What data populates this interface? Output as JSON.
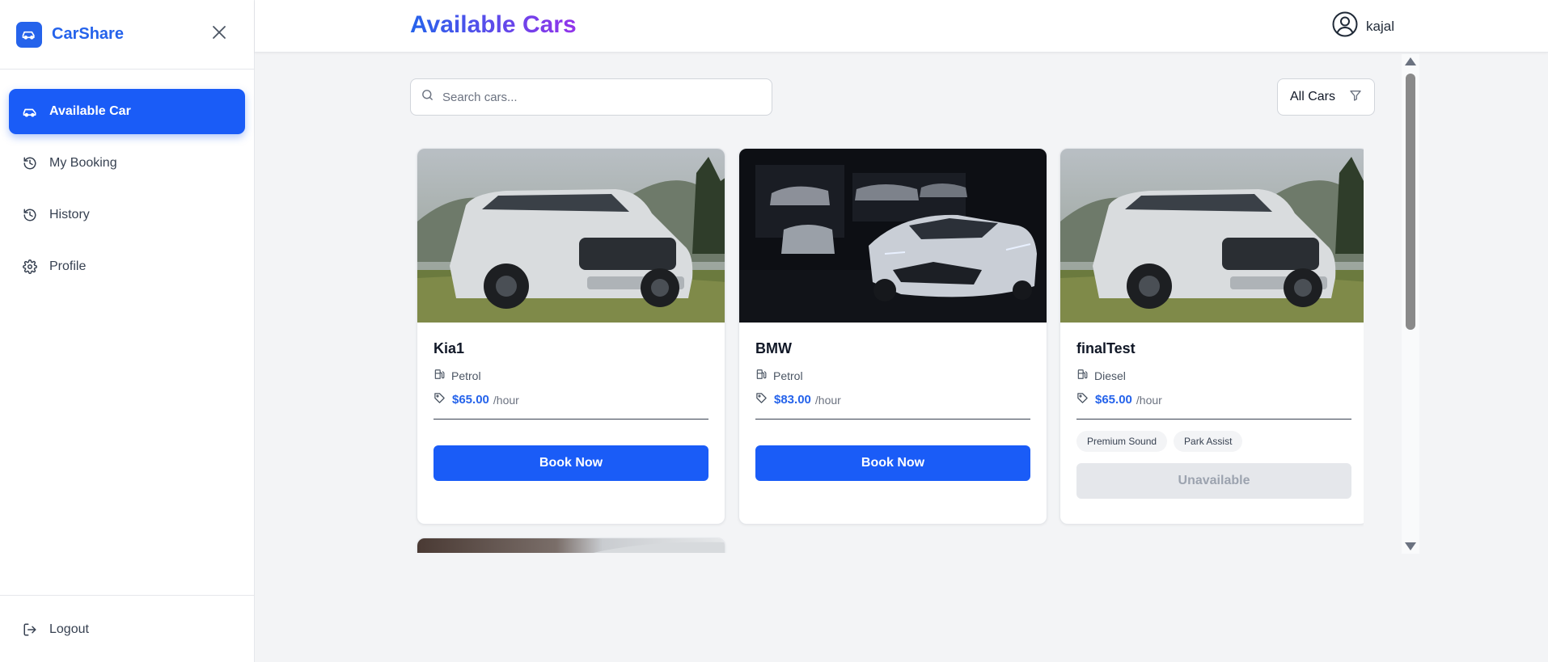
{
  "brand": {
    "name": "CarShare"
  },
  "sidebar": {
    "items": [
      {
        "label": "Available Car",
        "icon": "car-icon",
        "active": true
      },
      {
        "label": "My Booking",
        "icon": "history-icon"
      },
      {
        "label": "History",
        "icon": "history-icon"
      },
      {
        "label": "Profile",
        "icon": "gear-icon"
      }
    ],
    "logout": {
      "label": "Logout",
      "icon": "logout-icon"
    }
  },
  "header": {
    "title": "Available Cars",
    "username": "kajal"
  },
  "toolbar": {
    "search_placeholder": "Search cars...",
    "filter_value": "All Cars"
  },
  "cars": [
    {
      "name": "Kia1",
      "fuel": "Petrol",
      "price": "$65.00",
      "unit": "/hour",
      "action": "Book Now",
      "available": true
    },
    {
      "name": "BMW",
      "fuel": "Petrol",
      "price": "$83.00",
      "unit": "/hour",
      "action": "Book Now",
      "available": true
    },
    {
      "name": "finalTest",
      "fuel": "Diesel",
      "price": "$65.00",
      "unit": "/hour",
      "features": [
        "Premium Sound",
        "Park Assist"
      ],
      "action": "Unavailable",
      "available": false
    }
  ],
  "colors": {
    "primary": "#1a5cf7",
    "title_gradient_start": "#2563eb",
    "title_gradient_end": "#9333ea"
  }
}
